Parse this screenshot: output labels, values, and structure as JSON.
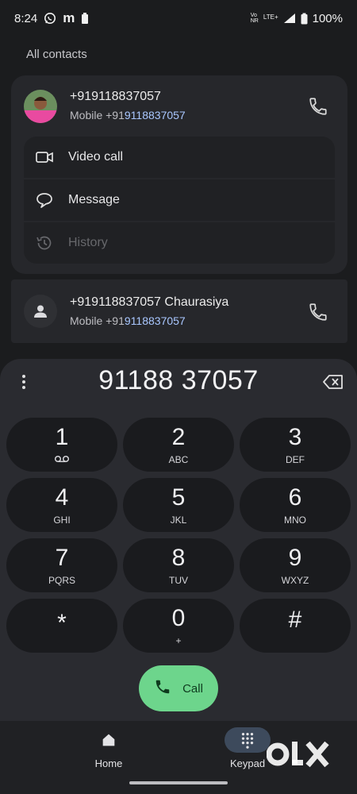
{
  "status_bar": {
    "time": "8:24",
    "volte_top": "Vo",
    "volte_bottom": "NR",
    "network": "LTE+",
    "battery": "100%"
  },
  "section_title": "All contacts",
  "contacts": [
    {
      "name": "+919118837057",
      "sub_prefix": "Mobile +91",
      "sub_highlight": "9118837057"
    },
    {
      "name": "+919118837057 Chaurasiya",
      "sub_prefix": "Mobile +91",
      "sub_highlight": "9118837057"
    }
  ],
  "actions": {
    "video_call": "Video call",
    "message": "Message",
    "history": "History"
  },
  "dialer": {
    "number": "91188 37057",
    "keys": [
      {
        "digit": "1",
        "letters": ""
      },
      {
        "digit": "2",
        "letters": "ABC"
      },
      {
        "digit": "3",
        "letters": "DEF"
      },
      {
        "digit": "4",
        "letters": "GHI"
      },
      {
        "digit": "5",
        "letters": "JKL"
      },
      {
        "digit": "6",
        "letters": "MNO"
      },
      {
        "digit": "7",
        "letters": "PQRS"
      },
      {
        "digit": "8",
        "letters": "TUV"
      },
      {
        "digit": "9",
        "letters": "WXYZ"
      },
      {
        "digit": "*",
        "letters": ""
      },
      {
        "digit": "0",
        "letters": "+"
      },
      {
        "digit": "#",
        "letters": ""
      }
    ],
    "call_label": "Call"
  },
  "bottom_nav": {
    "home": "Home",
    "keypad": "Keypad",
    "selected": "keypad"
  },
  "watermark": "OLX",
  "colors": {
    "background": "#1b1c1e",
    "accent_call": "#6dd58c",
    "link_blue": "#a9c7ff"
  }
}
